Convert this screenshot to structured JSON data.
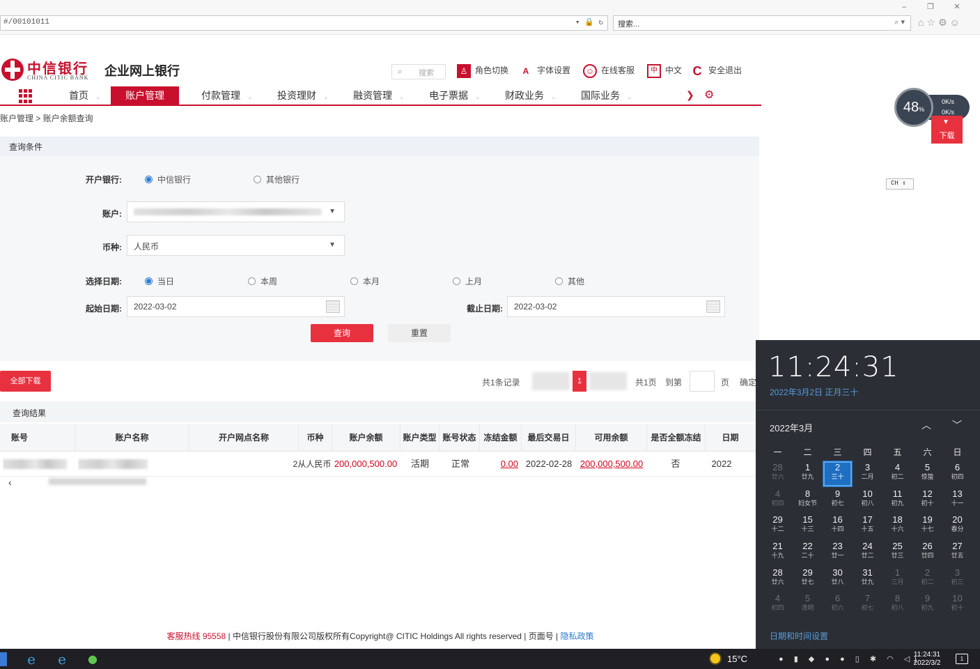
{
  "browser": {
    "address": "#/00101011",
    "search_placeholder": "搜索...",
    "window_buttons": [
      "–",
      "❐",
      "✕"
    ]
  },
  "header": {
    "logo_cn": "中信银行",
    "logo_en": "CHINA CITIC BANK",
    "site_title": "企业网上银行",
    "search_placeholder": "搜索",
    "tools": [
      {
        "label": "角色切换",
        "icon": "user-switch-icon",
        "color": "#c8102e"
      },
      {
        "label": "字体设置",
        "icon": "font-size-icon",
        "color": "#c8102e"
      },
      {
        "label": "在线客服",
        "icon": "customer-service-icon",
        "color": "#c8102e"
      },
      {
        "label": "中文",
        "icon": "language-icon",
        "color": "#c8102e"
      },
      {
        "label": "安全退出",
        "icon": "logout-icon",
        "color": "#c8102e"
      }
    ]
  },
  "nav": {
    "items": [
      {
        "label": "首页",
        "active": false
      },
      {
        "label": "账户管理",
        "active": true
      },
      {
        "label": "付款管理",
        "active": false
      },
      {
        "label": "投资理财",
        "active": false
      },
      {
        "label": "融资管理",
        "active": false
      },
      {
        "label": "电子票据",
        "active": false
      },
      {
        "label": "财政业务",
        "active": false
      },
      {
        "label": "国际业务",
        "active": false
      }
    ]
  },
  "breadcrumb": "账户管理 > 账户余额查询",
  "query": {
    "title": "查询条件",
    "bank_label": "开户银行:",
    "bank_options": [
      {
        "label": "中信银行",
        "checked": true
      },
      {
        "label": "其他银行",
        "checked": false
      }
    ],
    "account_label": "账户:",
    "currency_label": "币种:",
    "currency_value": "人民币",
    "date_label": "选择日期:",
    "date_options": [
      {
        "label": "当日",
        "checked": true
      },
      {
        "label": "本周",
        "checked": false
      },
      {
        "label": "本月",
        "checked": false
      },
      {
        "label": "上月",
        "checked": false
      },
      {
        "label": "其他",
        "checked": false
      }
    ],
    "start_label": "起始日期:",
    "start_value": "2022-03-02",
    "end_label": "截止日期:",
    "end_value": "2022-03-02",
    "query_button": "查询",
    "reset_button": "重置"
  },
  "results_bar": {
    "download_all": "全部下载",
    "total_records": "共1条记录",
    "current_page": "1",
    "total_pages": "共1页",
    "goto_label": "到第",
    "page_unit": "页",
    "confirm": "确定"
  },
  "results": {
    "title": "查询结果",
    "columns": [
      "账号",
      "账户名称",
      "开户网点名称",
      "币种",
      "账户余额",
      "账户类型",
      "账号状态",
      "冻结金额",
      "最后交易日",
      "可用余额",
      "是否全额冻结",
      "日期"
    ],
    "rows": [
      {
        "currency": "人民币",
        "currency_prefix": "2从",
        "balance": "200,000,500.00",
        "account_type": "活期",
        "status": "正常",
        "frozen_amount": "0.00",
        "last_trade_date": "2022-02-28",
        "available": "200,000,500.00",
        "fully_frozen": "否",
        "date": "2022"
      }
    ]
  },
  "footer": {
    "hotline": "客服热线 95558",
    "copyright": " | 中信银行股份有限公司版权所有Copyright@ CITIC Holdings All rights reserved | 页面号 | ",
    "privacy": "隐私政策"
  },
  "widgets": {
    "net_percent": "48",
    "net_percent_unit": "%",
    "net_up": "0K/s",
    "net_down": "0K/s",
    "download_label": "下载",
    "ime": "CH"
  },
  "clock": {
    "time": "11:24:31",
    "date_line": "2022年3月2日 正月三十",
    "month_label": "2022年3月",
    "weekdays": [
      "一",
      "二",
      "三",
      "四",
      "五",
      "六",
      "日"
    ],
    "settings_link": "日期和时间设置",
    "days": [
      {
        "d": "28",
        "l": "廿六",
        "dim": true
      },
      {
        "d": "1",
        "l": "廿九"
      },
      {
        "d": "2",
        "l": "三十",
        "today": true
      },
      {
        "d": "3",
        "l": "二月"
      },
      {
        "d": "4",
        "l": "初二"
      },
      {
        "d": "5",
        "l": "惊蛰"
      },
      {
        "d": "6",
        "l": "初四"
      },
      {
        "d": "4",
        "l": "初四",
        "dim": true
      },
      {
        "d": "8",
        "l": "妇女节"
      },
      {
        "d": "9",
        "l": "初七"
      },
      {
        "d": "10",
        "l": "初八"
      },
      {
        "d": "11",
        "l": "初九"
      },
      {
        "d": "12",
        "l": "初十"
      },
      {
        "d": "13",
        "l": "十一"
      },
      {
        "d": "29",
        "l": "十二"
      },
      {
        "d": "15",
        "l": "十三"
      },
      {
        "d": "16",
        "l": "十四"
      },
      {
        "d": "17",
        "l": "十五"
      },
      {
        "d": "18",
        "l": "十六"
      },
      {
        "d": "19",
        "l": "十七"
      },
      {
        "d": "20",
        "l": "春分"
      },
      {
        "d": "21",
        "l": "十九"
      },
      {
        "d": "22",
        "l": "二十"
      },
      {
        "d": "23",
        "l": "廿一"
      },
      {
        "d": "24",
        "l": "廿二"
      },
      {
        "d": "25",
        "l": "廿三"
      },
      {
        "d": "26",
        "l": "廿四"
      },
      {
        "d": "27",
        "l": "廿五"
      },
      {
        "d": "28",
        "l": "廿六"
      },
      {
        "d": "29",
        "l": "廿七"
      },
      {
        "d": "30",
        "l": "廿八"
      },
      {
        "d": "31",
        "l": "廿九"
      },
      {
        "d": "1",
        "l": "三月",
        "dim": true
      },
      {
        "d": "2",
        "l": "初二",
        "dim": true
      },
      {
        "d": "3",
        "l": "初三",
        "dim": true
      },
      {
        "d": "4",
        "l": "初四",
        "dim": true
      },
      {
        "d": "5",
        "l": "清明",
        "dim": true
      },
      {
        "d": "6",
        "l": "初六",
        "dim": true
      },
      {
        "d": "7",
        "l": "初七",
        "dim": true
      },
      {
        "d": "8",
        "l": "初八",
        "dim": true
      },
      {
        "d": "9",
        "l": "初九",
        "dim": true
      },
      {
        "d": "10",
        "l": "初十",
        "dim": true
      }
    ]
  },
  "taskbar": {
    "weather": "15°C",
    "clock_time": "11:24:31",
    "clock_date": "2022/3/2",
    "notify_count": "1"
  }
}
